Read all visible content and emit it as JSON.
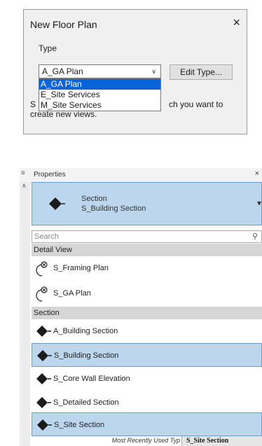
{
  "dialog": {
    "title": "New Floor Plan",
    "close": "×",
    "type_label": "Type",
    "selected_type": "A_GA Plan",
    "edit_type_label": "Edit Type...",
    "options": [
      "A_GA Plan",
      "E_Site Services",
      "M_Site Services"
    ],
    "desc_start": "S",
    "desc_tail": "ch you want to",
    "desc_line2": "create new views."
  },
  "properties": {
    "title": "Properties",
    "close": "×",
    "type_family": "Section",
    "type_name": "S_Building Section",
    "search_placeholder": "Search",
    "groups": [
      {
        "name": "Detail View",
        "items": [
          {
            "label": "S_Framing Plan",
            "icon": "detail-view-icon",
            "selected": false
          },
          {
            "label": "S_GA Plan",
            "icon": "detail-view-icon",
            "selected": false
          }
        ]
      },
      {
        "name": "Section",
        "items": [
          {
            "label": "A_Building Section",
            "icon": "section-icon",
            "selected": false
          },
          {
            "label": "S_Building Section",
            "icon": "section-icon",
            "selected": true
          },
          {
            "label": "S_Core Wall Elevation",
            "icon": "section-icon",
            "selected": false
          },
          {
            "label": "S_Detailed Section",
            "icon": "section-icon",
            "selected": false
          },
          {
            "label": "S_Site Section",
            "icon": "section-icon",
            "selected": true
          }
        ]
      }
    ],
    "footer_left": "Most Recently Used Typ",
    "footer_right": "S_Site Section"
  },
  "colors": {
    "selection": "#bcd6ee",
    "dropdown_highlight": "#0a64d6"
  }
}
